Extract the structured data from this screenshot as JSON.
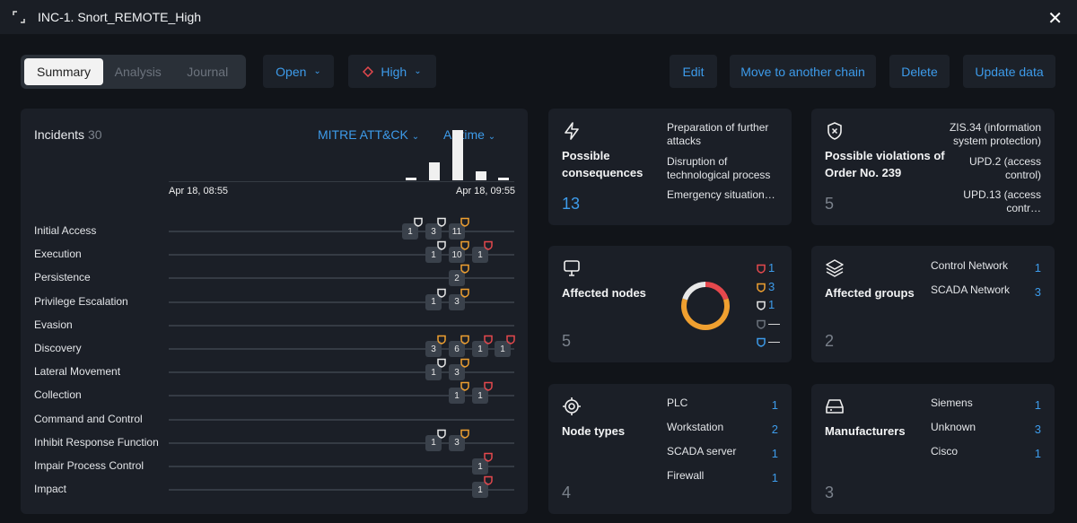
{
  "window": {
    "title": "INC-1. Snort_REMOTE_High"
  },
  "tabs": [
    {
      "label": "Summary",
      "active": true
    },
    {
      "label": "Analysis"
    },
    {
      "label": "Journal"
    }
  ],
  "status_dropdown": "Open",
  "severity_dropdown": {
    "label": "High",
    "color": "#e5484d"
  },
  "actions": {
    "edit": "Edit",
    "move": "Move to another chain",
    "delete": "Delete",
    "update": "Update data"
  },
  "colors": {
    "accent": "#3d9bea",
    "high": "#e5484d",
    "medium": "#f0a030",
    "low": "#e8e8e8",
    "unknown": "#6c737d",
    "info": "#3d9bea"
  },
  "incidents": {
    "title": "Incidents",
    "count": "30",
    "framework": "MITRE ATT&CK",
    "period": "All time",
    "time_start": "Apr 18, 08:55",
    "time_end": "Apr 18, 09:55",
    "histogram": [
      1,
      6,
      17,
      3,
      1
    ],
    "tactics": [
      {
        "name": "Initial Access",
        "markers": [
          {
            "col": 0,
            "count": "1",
            "sev": "low"
          },
          {
            "col": 1,
            "count": "3",
            "sev": "low"
          },
          {
            "col": 2,
            "count": "11",
            "sev": "medium"
          }
        ]
      },
      {
        "name": "Execution",
        "markers": [
          {
            "col": 1,
            "count": "1",
            "sev": "low"
          },
          {
            "col": 2,
            "count": "10",
            "sev": "medium"
          },
          {
            "col": 3,
            "count": "1",
            "sev": "high"
          }
        ]
      },
      {
        "name": "Persistence",
        "markers": [
          {
            "col": 2,
            "count": "2",
            "sev": "medium"
          }
        ]
      },
      {
        "name": "Privilege Escalation",
        "markers": [
          {
            "col": 1,
            "count": "1",
            "sev": "low"
          },
          {
            "col": 2,
            "count": "3",
            "sev": "medium"
          }
        ]
      },
      {
        "name": "Evasion",
        "markers": []
      },
      {
        "name": "Discovery",
        "markers": [
          {
            "col": 1,
            "count": "3",
            "sev": "medium"
          },
          {
            "col": 2,
            "count": "6",
            "sev": "medium"
          },
          {
            "col": 3,
            "count": "1",
            "sev": "high"
          },
          {
            "col": 4,
            "count": "1",
            "sev": "high"
          }
        ]
      },
      {
        "name": "Lateral Movement",
        "markers": [
          {
            "col": 1,
            "count": "1",
            "sev": "low"
          },
          {
            "col": 2,
            "count": "3",
            "sev": "medium"
          }
        ]
      },
      {
        "name": "Collection",
        "markers": [
          {
            "col": 2,
            "count": "1",
            "sev": "medium"
          },
          {
            "col": 3,
            "count": "1",
            "sev": "high"
          }
        ]
      },
      {
        "name": "Command and Control",
        "markers": []
      },
      {
        "name": "Inhibit Response Function",
        "markers": [
          {
            "col": 1,
            "count": "1",
            "sev": "low"
          },
          {
            "col": 2,
            "count": "3",
            "sev": "medium"
          }
        ]
      },
      {
        "name": "Impair Process Control",
        "markers": [
          {
            "col": 3,
            "count": "1",
            "sev": "high"
          }
        ]
      },
      {
        "name": "Impact",
        "markers": [
          {
            "col": 3,
            "count": "1",
            "sev": "high"
          }
        ]
      }
    ]
  },
  "consequences": {
    "title": "Possible consequences",
    "count": "13",
    "items": [
      "Preparation of further attacks",
      "Disruption of technological process",
      "Emergency situation…"
    ]
  },
  "violations": {
    "title": "Possible violations of Order No. 239",
    "count": "5",
    "items": [
      "ZIS.34 (information system protection)",
      "UPD.2 (access control)",
      "UPD.13 (access contr…"
    ]
  },
  "nodes": {
    "title": "Affected nodes",
    "count": "5",
    "legend": [
      {
        "sev": "high",
        "value": "1"
      },
      {
        "sev": "medium",
        "value": "3"
      },
      {
        "sev": "low",
        "value": "1"
      },
      {
        "sev": "unknown",
        "value": "—"
      },
      {
        "sev": "info",
        "value": "—"
      }
    ]
  },
  "groups": {
    "title": "Affected groups",
    "count": "2",
    "items": [
      {
        "name": "Control Network",
        "value": "1"
      },
      {
        "name": "SCADA Network",
        "value": "3"
      }
    ]
  },
  "node_types": {
    "title": "Node types",
    "count": "4",
    "items": [
      {
        "name": "PLC",
        "value": "1"
      },
      {
        "name": "Workstation",
        "value": "2"
      },
      {
        "name": "SCADA server",
        "value": "1"
      },
      {
        "name": "Firewall",
        "value": "1"
      }
    ]
  },
  "manufacturers": {
    "title": "Manufacturers",
    "count": "3",
    "items": [
      {
        "name": "Siemens",
        "value": "1"
      },
      {
        "name": "Unknown",
        "value": "3"
      },
      {
        "name": "Cisco",
        "value": "1"
      }
    ]
  }
}
